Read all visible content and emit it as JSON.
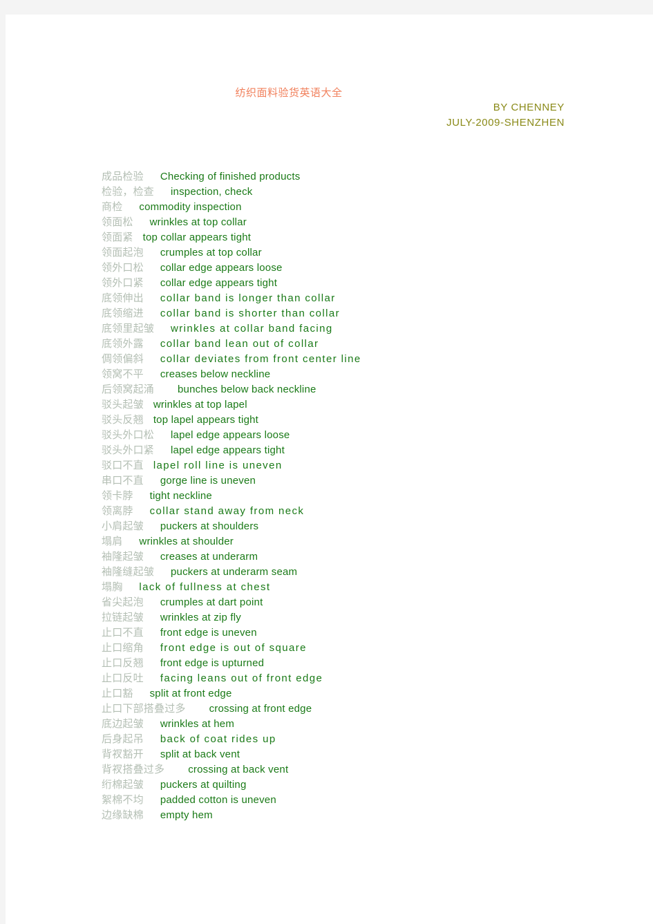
{
  "document": {
    "title": "纺织面料验货英语大全",
    "byline": {
      "author": "BY  CHENNEY",
      "dateline": "JULY-2009-SHENZHEN"
    },
    "colors": {
      "title": "#f1805c",
      "byline": "#8a8a18",
      "chinese_term": "#b4bfb4",
      "english_term": "#1a7a17",
      "page_background": "#ffffff",
      "canvas_background": "#f4f4f4"
    },
    "entries": [
      {
        "zh": "成品检验",
        "en": "Checking of finished products",
        "gap": "gap-m",
        "spacing": ""
      },
      {
        "zh": "检验，检查",
        "en": "inspection, check",
        "gap": "gap-m",
        "spacing": ""
      },
      {
        "zh": "商检",
        "en": "commodity inspection",
        "gap": "gap-m",
        "spacing": ""
      },
      {
        "zh": "领面松",
        "en": "wrinkles at top collar",
        "gap": "gap-m",
        "spacing": ""
      },
      {
        "zh": "领面紧",
        "en": "top collar appears tight",
        "gap": "gap-s",
        "spacing": ""
      },
      {
        "zh": "领面起泡",
        "en": "crumples at top collar",
        "gap": "gap-m",
        "spacing": ""
      },
      {
        "zh": "领外口松",
        "en": "collar edge appears loose",
        "gap": "gap-m",
        "spacing": ""
      },
      {
        "zh": "领外口紧",
        "en": "collar edge appears tight",
        "gap": "gap-m",
        "spacing": ""
      },
      {
        "zh": "底领伸出",
        "en": "collar band is longer than collar",
        "gap": "gap-m",
        "spacing": "sp-x"
      },
      {
        "zh": "底领缩进",
        "en": "collar band is shorter than collar",
        "gap": "gap-m",
        "spacing": "sp-x"
      },
      {
        "zh": "底领里起皱",
        "en": "wrinkles at collar band facing",
        "gap": "gap-m",
        "spacing": "sp-x"
      },
      {
        "zh": "底领外露",
        "en": "collar band lean out of collar",
        "gap": "gap-m",
        "spacing": "sp-x"
      },
      {
        "zh": "倜领偏斜",
        "en": "collar deviates from front center line",
        "gap": "gap-m",
        "spacing": "sp-x"
      },
      {
        "zh": "领窝不平",
        "en": "creases below neckline",
        "gap": "gap-m",
        "spacing": ""
      },
      {
        "zh": "后领窝起涌",
        "en": "bunches below back neckline",
        "gap": "gap-l",
        "spacing": ""
      },
      {
        "zh": "驳头起皱",
        "en": "wrinkles at top lapel",
        "gap": "gap-s",
        "spacing": ""
      },
      {
        "zh": "驳头反翘",
        "en": "top lapel appears tight",
        "gap": "gap-s",
        "spacing": ""
      },
      {
        "zh": "驳头外口松",
        "en": "lapel edge appears loose",
        "gap": "gap-m",
        "spacing": ""
      },
      {
        "zh": "驳头外口紧",
        "en": "lapel edge appears tight",
        "gap": "gap-m",
        "spacing": ""
      },
      {
        "zh": "驳口不直",
        "en": "lapel roll line is uneven",
        "gap": "gap-s",
        "spacing": "sp-x"
      },
      {
        "zh": "串口不直",
        "en": "gorge line is uneven",
        "gap": "gap-m",
        "spacing": ""
      },
      {
        "zh": "领卡脖",
        "en": "tight neckline",
        "gap": "gap-m",
        "spacing": ""
      },
      {
        "zh": "领离脖",
        "en": "collar stand away from neck",
        "gap": "gap-m",
        "spacing": "sp-x"
      },
      {
        "zh": "小肩起皱",
        "en": "puckers at shoulders",
        "gap": "gap-m",
        "spacing": ""
      },
      {
        "zh": "塌肩",
        "en": "wrinkles at shoulder",
        "gap": "gap-m",
        "spacing": ""
      },
      {
        "zh": "袖隆起皱",
        "en": "creases at underarm",
        "gap": "gap-m",
        "spacing": ""
      },
      {
        "zh": "袖隆缝起皱",
        "en": "puckers at underarm seam",
        "gap": "gap-m",
        "spacing": ""
      },
      {
        "zh": "塌胸",
        "en": "lack of fullness at chest",
        "gap": "gap-m",
        "spacing": "sp-x"
      },
      {
        "zh": "省尖起泡",
        "en": "crumples at dart point",
        "gap": "gap-m",
        "spacing": ""
      },
      {
        "zh": "拉链起皱",
        "en": "wrinkles at zip fly",
        "gap": "gap-m",
        "spacing": ""
      },
      {
        "zh": "止口不直",
        "en": "front edge is uneven",
        "gap": "gap-m",
        "spacing": ""
      },
      {
        "zh": "止口缩角",
        "en": "front edge is out of square",
        "gap": "gap-m",
        "spacing": "sp-x"
      },
      {
        "zh": "止口反翘",
        "en": "front edge is upturned",
        "gap": "gap-m",
        "spacing": ""
      },
      {
        "zh": "止口反吐",
        "en": "facing leans out of front edge",
        "gap": "gap-m",
        "spacing": "sp-x"
      },
      {
        "zh": "止口豁",
        "en": "split at front edge",
        "gap": "gap-m",
        "spacing": ""
      },
      {
        "zh": "止口下部搭叠过多",
        "en": "crossing at front edge",
        "gap": "gap-l",
        "spacing": ""
      },
      {
        "zh": "底边起皱",
        "en": "wrinkles at hem",
        "gap": "gap-m",
        "spacing": ""
      },
      {
        "zh": "后身起吊",
        "en": "back of coat rides up",
        "gap": "gap-m",
        "spacing": "sp-x"
      },
      {
        "zh": "背衩豁开",
        "en": "split at back vent",
        "gap": "gap-m",
        "spacing": ""
      },
      {
        "zh": "背衩搭叠过多",
        "en": "crossing at back vent",
        "gap": "gap-l",
        "spacing": ""
      },
      {
        "zh": "绗棉起皱",
        "en": "puckers at quilting",
        "gap": "gap-m",
        "spacing": ""
      },
      {
        "zh": "絮棉不均",
        "en": "padded cotton is uneven",
        "gap": "gap-m",
        "spacing": ""
      },
      {
        "zh": "边缘缺棉",
        "en": "empty hem",
        "gap": "gap-m",
        "spacing": ""
      }
    ]
  }
}
